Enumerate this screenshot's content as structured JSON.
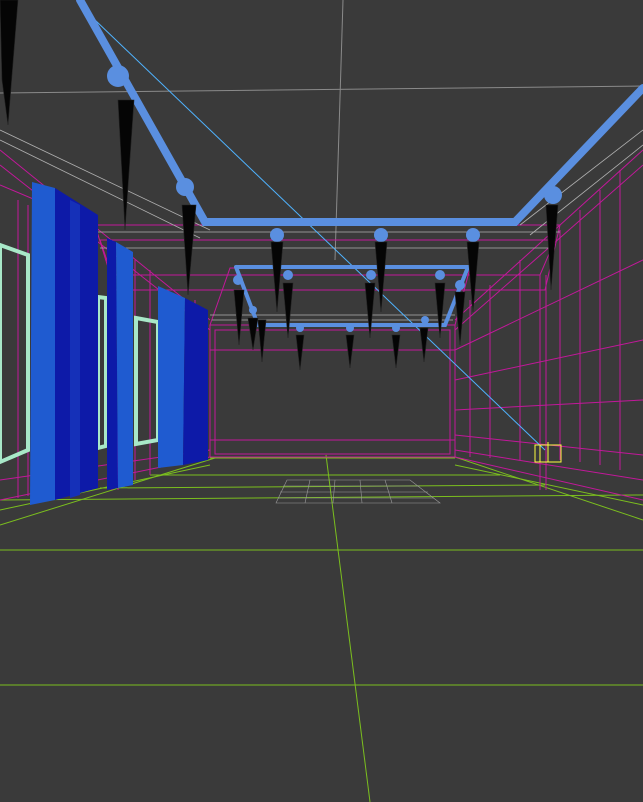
{
  "viewport": {
    "background": "#3a3a3a",
    "colors": {
      "wireframe_magenta": "#c2189a",
      "grid_green": "#7bbf1e",
      "ceiling_blue": "#5a8fe0",
      "curtain_dark": "#0d1aa8",
      "curtain_light": "#1f5bd0",
      "window_green": "#a8e8c8",
      "grid_light": "#8a8a8a",
      "selection_yellow": "#ffff40",
      "view_line": "#4fb3ff"
    },
    "icons": [
      "pendant-lamp-icon",
      "ceiling-track-icon",
      "curtain-icon",
      "floor-grid-icon"
    ]
  }
}
